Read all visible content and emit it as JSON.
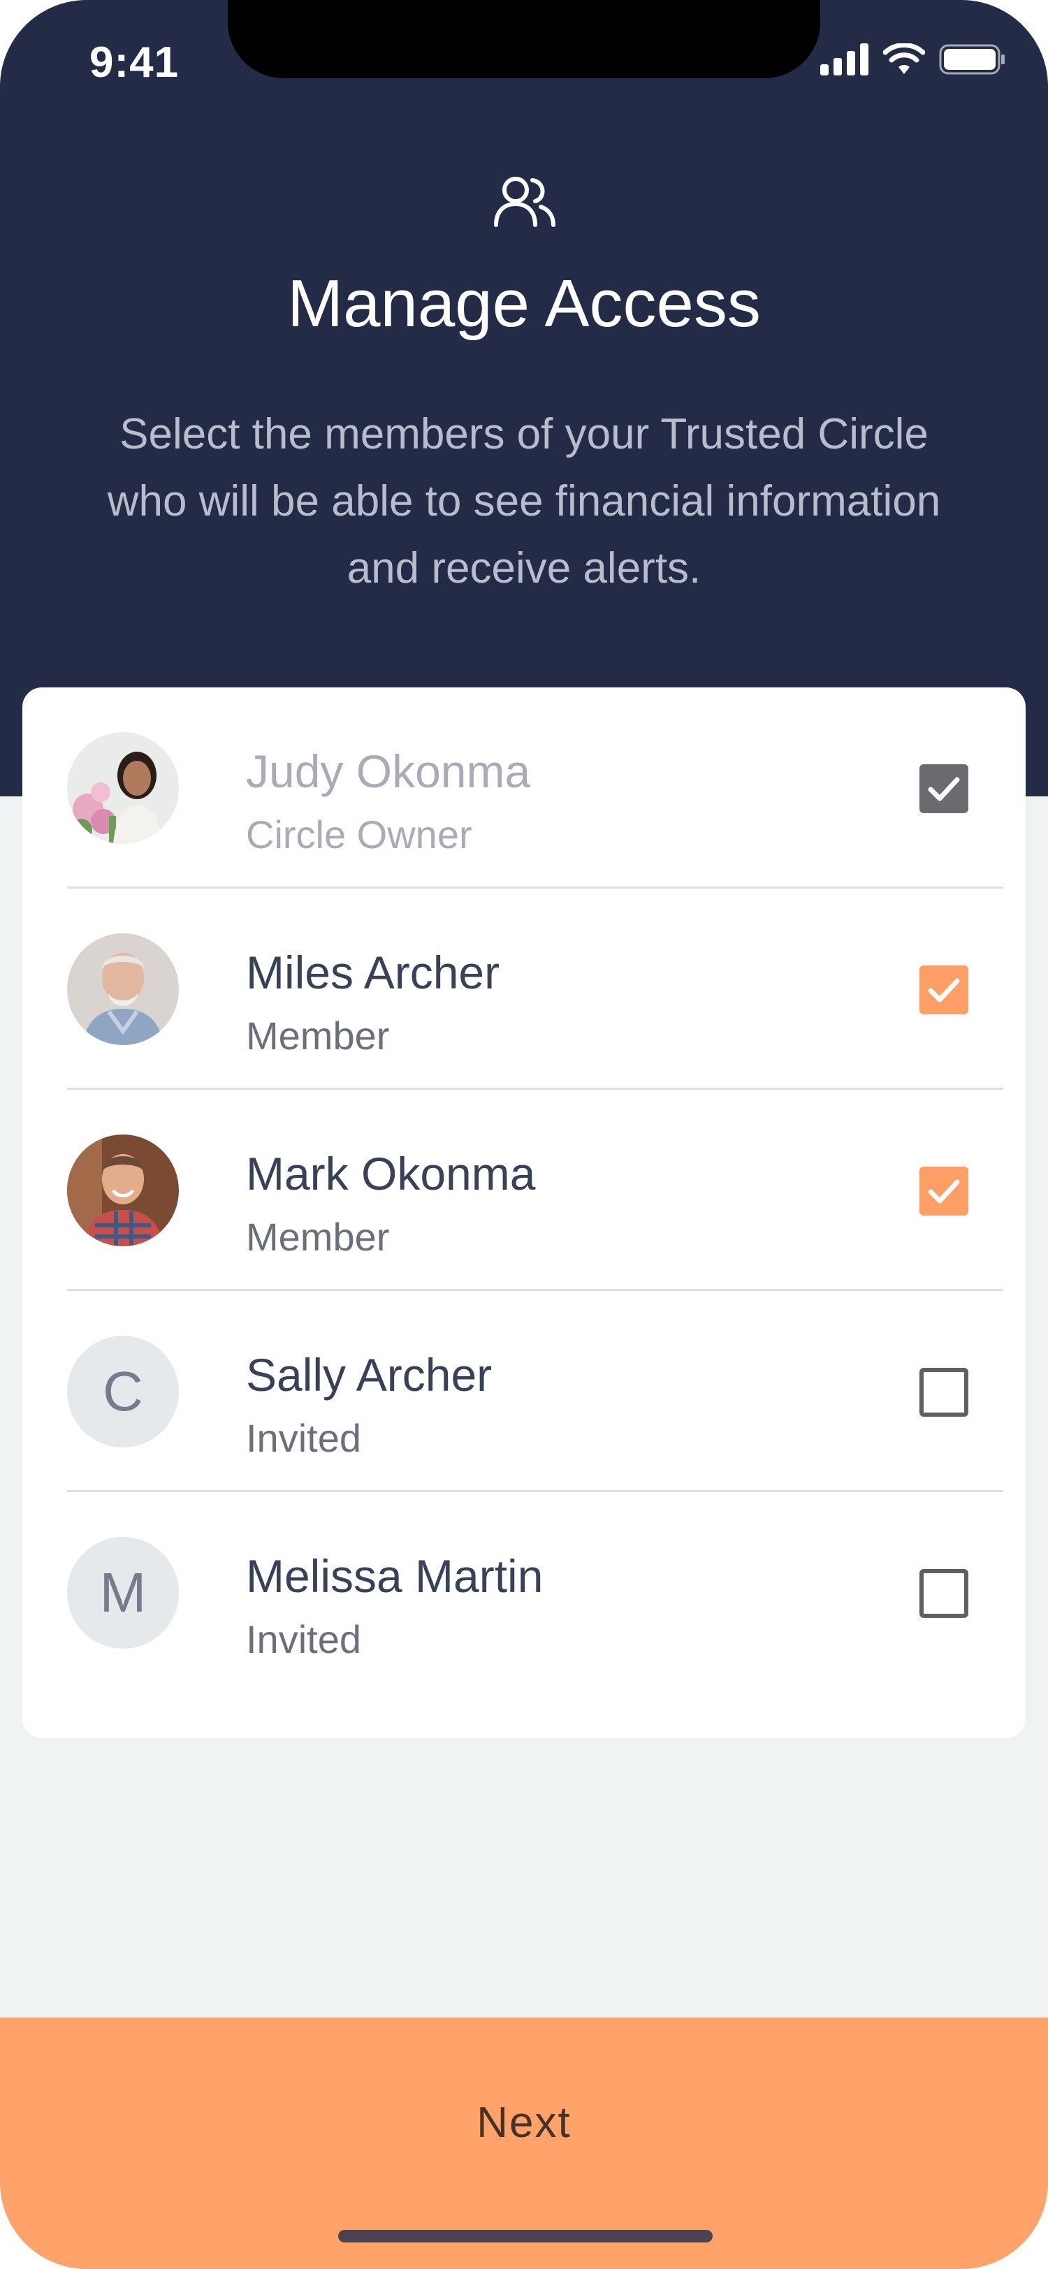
{
  "status_bar": {
    "time": "9:41",
    "icons": [
      "signal-icon",
      "wifi-icon",
      "battery-icon"
    ]
  },
  "header": {
    "icon": "people-icon",
    "title": "Manage Access",
    "subtitle": "Select the members of your Trusted Circle who will be able to see financial information and receive alerts."
  },
  "members": [
    {
      "name": "Judy Okonma",
      "role": "Circle Owner",
      "avatar": "photo",
      "checked": true,
      "locked": true
    },
    {
      "name": "Miles Archer",
      "role": "Member",
      "avatar": "photo",
      "checked": true,
      "locked": false
    },
    {
      "name": "Mark Okonma",
      "role": "Member",
      "avatar": "photo",
      "checked": true,
      "locked": false
    },
    {
      "name": "Sally Archer",
      "role": "Invited",
      "avatar_initial": "C",
      "checked": false,
      "locked": false
    },
    {
      "name": "Melissa Martin",
      "role": "Invited",
      "avatar_initial": "M",
      "checked": false,
      "locked": false
    }
  ],
  "footer": {
    "next_label": "Next"
  },
  "colors": {
    "header_bg": "#232b46",
    "accent": "#ffa36b",
    "page_bg": "#f0f3f4"
  }
}
